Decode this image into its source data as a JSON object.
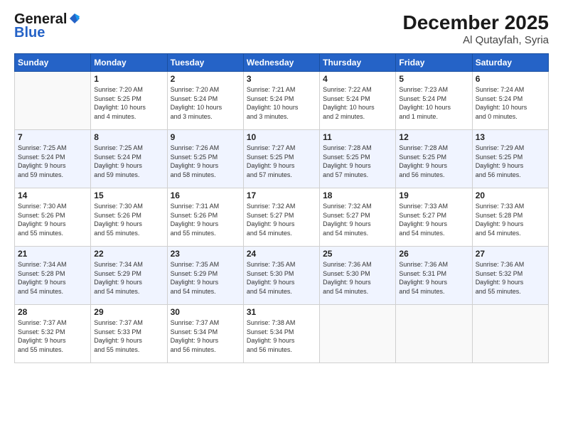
{
  "logo": {
    "line1": "General",
    "line2": "Blue"
  },
  "title": "December 2025",
  "location": "Al Qutayfah, Syria",
  "weekdays": [
    "Sunday",
    "Monday",
    "Tuesday",
    "Wednesday",
    "Thursday",
    "Friday",
    "Saturday"
  ],
  "weeks": [
    [
      {
        "day": "",
        "content": ""
      },
      {
        "day": "1",
        "content": "Sunrise: 7:20 AM\nSunset: 5:25 PM\nDaylight: 10 hours\nand 4 minutes."
      },
      {
        "day": "2",
        "content": "Sunrise: 7:20 AM\nSunset: 5:24 PM\nDaylight: 10 hours\nand 3 minutes."
      },
      {
        "day": "3",
        "content": "Sunrise: 7:21 AM\nSunset: 5:24 PM\nDaylight: 10 hours\nand 3 minutes."
      },
      {
        "day": "4",
        "content": "Sunrise: 7:22 AM\nSunset: 5:24 PM\nDaylight: 10 hours\nand 2 minutes."
      },
      {
        "day": "5",
        "content": "Sunrise: 7:23 AM\nSunset: 5:24 PM\nDaylight: 10 hours\nand 1 minute."
      },
      {
        "day": "6",
        "content": "Sunrise: 7:24 AM\nSunset: 5:24 PM\nDaylight: 10 hours\nand 0 minutes."
      }
    ],
    [
      {
        "day": "7",
        "content": "Sunrise: 7:25 AM\nSunset: 5:24 PM\nDaylight: 9 hours\nand 59 minutes."
      },
      {
        "day": "8",
        "content": "Sunrise: 7:25 AM\nSunset: 5:24 PM\nDaylight: 9 hours\nand 59 minutes."
      },
      {
        "day": "9",
        "content": "Sunrise: 7:26 AM\nSunset: 5:25 PM\nDaylight: 9 hours\nand 58 minutes."
      },
      {
        "day": "10",
        "content": "Sunrise: 7:27 AM\nSunset: 5:25 PM\nDaylight: 9 hours\nand 57 minutes."
      },
      {
        "day": "11",
        "content": "Sunrise: 7:28 AM\nSunset: 5:25 PM\nDaylight: 9 hours\nand 57 minutes."
      },
      {
        "day": "12",
        "content": "Sunrise: 7:28 AM\nSunset: 5:25 PM\nDaylight: 9 hours\nand 56 minutes."
      },
      {
        "day": "13",
        "content": "Sunrise: 7:29 AM\nSunset: 5:25 PM\nDaylight: 9 hours\nand 56 minutes."
      }
    ],
    [
      {
        "day": "14",
        "content": "Sunrise: 7:30 AM\nSunset: 5:26 PM\nDaylight: 9 hours\nand 55 minutes."
      },
      {
        "day": "15",
        "content": "Sunrise: 7:30 AM\nSunset: 5:26 PM\nDaylight: 9 hours\nand 55 minutes."
      },
      {
        "day": "16",
        "content": "Sunrise: 7:31 AM\nSunset: 5:26 PM\nDaylight: 9 hours\nand 55 minutes."
      },
      {
        "day": "17",
        "content": "Sunrise: 7:32 AM\nSunset: 5:27 PM\nDaylight: 9 hours\nand 54 minutes."
      },
      {
        "day": "18",
        "content": "Sunrise: 7:32 AM\nSunset: 5:27 PM\nDaylight: 9 hours\nand 54 minutes."
      },
      {
        "day": "19",
        "content": "Sunrise: 7:33 AM\nSunset: 5:27 PM\nDaylight: 9 hours\nand 54 minutes."
      },
      {
        "day": "20",
        "content": "Sunrise: 7:33 AM\nSunset: 5:28 PM\nDaylight: 9 hours\nand 54 minutes."
      }
    ],
    [
      {
        "day": "21",
        "content": "Sunrise: 7:34 AM\nSunset: 5:28 PM\nDaylight: 9 hours\nand 54 minutes."
      },
      {
        "day": "22",
        "content": "Sunrise: 7:34 AM\nSunset: 5:29 PM\nDaylight: 9 hours\nand 54 minutes."
      },
      {
        "day": "23",
        "content": "Sunrise: 7:35 AM\nSunset: 5:29 PM\nDaylight: 9 hours\nand 54 minutes."
      },
      {
        "day": "24",
        "content": "Sunrise: 7:35 AM\nSunset: 5:30 PM\nDaylight: 9 hours\nand 54 minutes."
      },
      {
        "day": "25",
        "content": "Sunrise: 7:36 AM\nSunset: 5:30 PM\nDaylight: 9 hours\nand 54 minutes."
      },
      {
        "day": "26",
        "content": "Sunrise: 7:36 AM\nSunset: 5:31 PM\nDaylight: 9 hours\nand 54 minutes."
      },
      {
        "day": "27",
        "content": "Sunrise: 7:36 AM\nSunset: 5:32 PM\nDaylight: 9 hours\nand 55 minutes."
      }
    ],
    [
      {
        "day": "28",
        "content": "Sunrise: 7:37 AM\nSunset: 5:32 PM\nDaylight: 9 hours\nand 55 minutes."
      },
      {
        "day": "29",
        "content": "Sunrise: 7:37 AM\nSunset: 5:33 PM\nDaylight: 9 hours\nand 55 minutes."
      },
      {
        "day": "30",
        "content": "Sunrise: 7:37 AM\nSunset: 5:34 PM\nDaylight: 9 hours\nand 56 minutes."
      },
      {
        "day": "31",
        "content": "Sunrise: 7:38 AM\nSunset: 5:34 PM\nDaylight: 9 hours\nand 56 minutes."
      },
      {
        "day": "",
        "content": ""
      },
      {
        "day": "",
        "content": ""
      },
      {
        "day": "",
        "content": ""
      }
    ]
  ]
}
